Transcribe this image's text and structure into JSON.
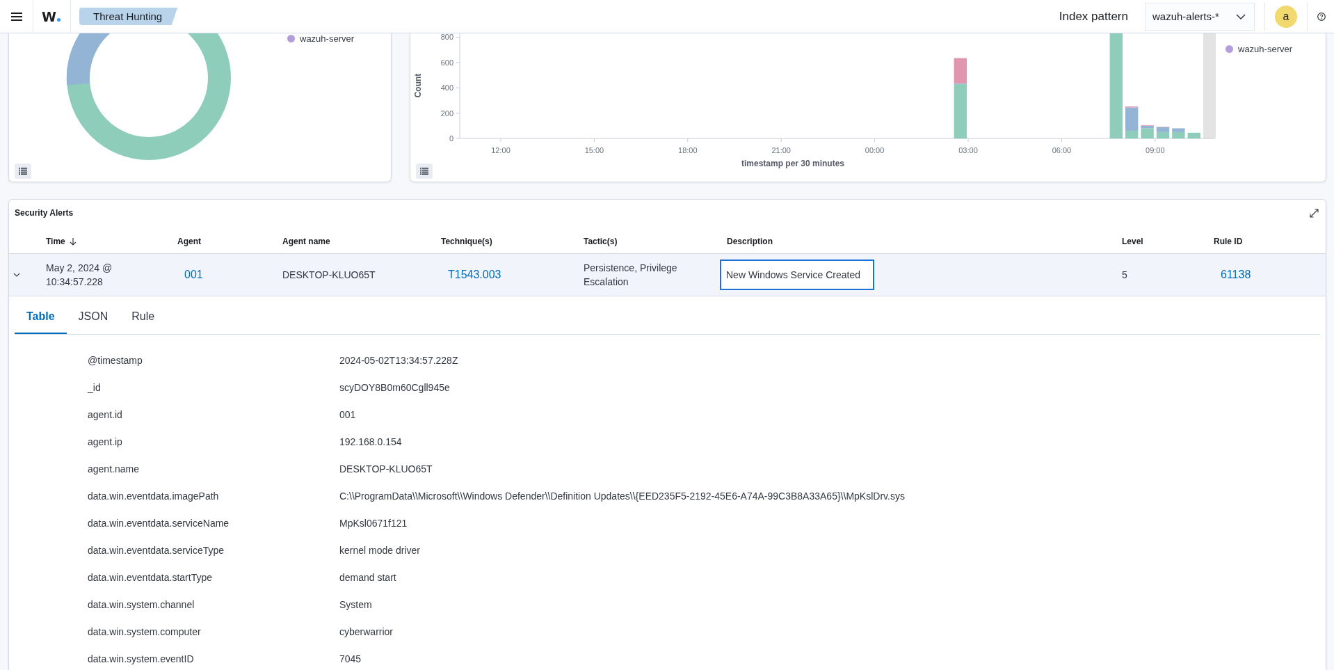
{
  "header": {
    "logo": "W",
    "breadcrumb": "Threat Hunting",
    "index_pattern_label": "Index pattern",
    "index_pattern_value": "wazuh-alerts-*",
    "avatar": "a"
  },
  "donut_panel": {
    "legend": [
      {
        "label": "wazuh-server",
        "color": "#b39ddb"
      }
    ]
  },
  "histogram_panel": {
    "legend": [
      {
        "label": "wazuh-server",
        "color": "#b39ddb"
      }
    ],
    "chart_data": {
      "type": "bar",
      "stacked": true,
      "xlabel": "timestamp per 30 minutes",
      "ylabel": "Count",
      "ylim": [
        0,
        830
      ],
      "categories": [
        null,
        null,
        "12:00",
        null,
        null,
        null,
        null,
        null,
        "15:00",
        null,
        null,
        null,
        null,
        null,
        "18:00",
        null,
        null,
        null,
        null,
        null,
        "21:00",
        null,
        null,
        null,
        null,
        null,
        "00:00",
        null,
        null,
        null,
        null,
        null,
        "03:00",
        null,
        null,
        null,
        null,
        null,
        "06:00",
        null,
        null,
        null,
        null,
        null,
        "09:00",
        null,
        null,
        null
      ],
      "yticks": [
        0,
        200,
        400,
        600,
        800
      ],
      "series": [
        {
          "color": "#8ecdb9",
          "values": [
            0,
            0,
            0,
            0,
            0,
            0,
            0,
            0,
            0,
            0,
            0,
            0,
            0,
            0,
            0,
            0,
            0,
            0,
            0,
            0,
            0,
            0,
            0,
            0,
            0,
            0,
            0,
            0,
            0,
            0,
            0,
            430,
            0,
            0,
            0,
            0,
            0,
            0,
            0,
            0,
            0,
            830,
            60,
            80,
            50,
            50,
            45,
            0
          ]
        },
        {
          "color": "#94b4d6",
          "values": [
            0,
            0,
            0,
            0,
            0,
            0,
            0,
            0,
            0,
            0,
            0,
            0,
            0,
            0,
            0,
            0,
            0,
            0,
            0,
            0,
            0,
            0,
            0,
            0,
            0,
            0,
            0,
            0,
            0,
            0,
            0,
            5,
            0,
            0,
            0,
            0,
            0,
            0,
            0,
            0,
            0,
            0,
            185,
            20,
            40,
            30,
            0,
            0
          ]
        },
        {
          "color": "#e295ae",
          "values": [
            0,
            0,
            0,
            0,
            0,
            0,
            0,
            0,
            0,
            0,
            0,
            0,
            0,
            0,
            0,
            0,
            0,
            0,
            0,
            0,
            0,
            0,
            0,
            0,
            0,
            0,
            0,
            0,
            0,
            0,
            0,
            200,
            0,
            0,
            0,
            0,
            0,
            0,
            0,
            0,
            0,
            0,
            8,
            5,
            3,
            0,
            0,
            0
          ]
        }
      ]
    }
  },
  "alerts": {
    "title": "Security Alerts",
    "columns": [
      {
        "label": "Time",
        "sorted": true
      },
      {
        "label": "Agent",
        "sorted": false
      },
      {
        "label": "Agent name",
        "sorted": false
      },
      {
        "label": "Technique(s)",
        "sorted": false
      },
      {
        "label": "Tactic(s)",
        "sorted": false
      },
      {
        "label": "Description",
        "sorted": false
      },
      {
        "label": "Level",
        "sorted": false
      },
      {
        "label": "Rule ID",
        "sorted": false
      }
    ],
    "rows": [
      {
        "expanded": true,
        "cells": [
          {
            "kind": "text",
            "text": "May 2, 2024 @ 10:34:57.228",
            "focused": false
          },
          {
            "kind": "link",
            "text": "001",
            "focused": false
          },
          {
            "kind": "text",
            "text": "DESKTOP-KLUO65T",
            "focused": false
          },
          {
            "kind": "link",
            "text": "T1543.003",
            "focused": false
          },
          {
            "kind": "text",
            "text": "Persistence, Privilege Escalation",
            "focused": false
          },
          {
            "kind": "text",
            "text": "New Windows Service Created",
            "focused": true
          },
          {
            "kind": "text",
            "text": "5",
            "focused": false
          },
          {
            "kind": "link",
            "text": "61138",
            "focused": false
          }
        ]
      }
    ],
    "detail_tabs": [
      {
        "label": "Table",
        "selected": true
      },
      {
        "label": "JSON",
        "selected": false
      },
      {
        "label": "Rule",
        "selected": false
      }
    ],
    "fields": [
      {
        "key": "@timestamp",
        "value": "2024-05-02T13:34:57.228Z"
      },
      {
        "key": "_id",
        "value": "scyDOY8B0m60Cgll945e"
      },
      {
        "key": "agent.id",
        "value": "001"
      },
      {
        "key": "agent.ip",
        "value": "192.168.0.154"
      },
      {
        "key": "agent.name",
        "value": "DESKTOP-KLUO65T"
      },
      {
        "key": "data.win.eventdata.imagePath",
        "value": "C:\\\\ProgramData\\\\Microsoft\\\\Windows Defender\\\\Definition Updates\\\\{EED235F5-2192-45E6-A74A-99C3B8A33A65}\\\\MpKslDrv.sys"
      },
      {
        "key": "data.win.eventdata.serviceName",
        "value": "MpKsl0671f121"
      },
      {
        "key": "data.win.eventdata.serviceType",
        "value": "kernel mode driver"
      },
      {
        "key": "data.win.eventdata.startType",
        "value": "demand start"
      },
      {
        "key": "data.win.system.channel",
        "value": "System"
      },
      {
        "key": "data.win.system.computer",
        "value": "cyberwarrior"
      },
      {
        "key": "data.win.system.eventID",
        "value": "7045"
      }
    ]
  }
}
